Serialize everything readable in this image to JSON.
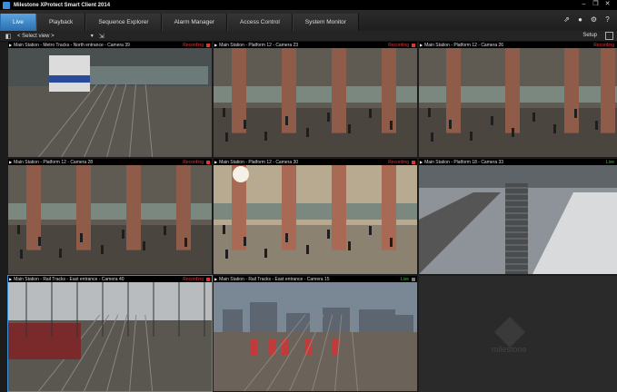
{
  "app": {
    "title": "Milestone XProtect Smart Client 2014"
  },
  "window_controls": [
    "minimize-icon",
    "restore-icon",
    "close-icon"
  ],
  "tabs": [
    {
      "label": "Live",
      "active": true
    },
    {
      "label": "Playback",
      "active": false
    },
    {
      "label": "Sequence Explorer",
      "active": false
    },
    {
      "label": "Alarm Manager",
      "active": false
    },
    {
      "label": "Access Control",
      "active": false
    },
    {
      "label": "System Monitor",
      "active": false
    }
  ],
  "toolbar_icons": [
    "pin-icon",
    "status-icon",
    "gear-icon",
    "help-icon"
  ],
  "viewbar": {
    "select_view": "< Select view >",
    "setup": "Setup"
  },
  "cameras": [
    {
      "name": "Main Station - Metro Tracks - North entrance - Camera 39",
      "status": "Recording",
      "scene": "metro-train"
    },
    {
      "name": "Main Station - Platform 12 - Camera 23",
      "status": "Recording",
      "scene": "station-hall"
    },
    {
      "name": "Main Station - Platform 12 - Camera 26",
      "status": "Recording",
      "scene": "station-hall-wide"
    },
    {
      "name": "Main Station - Platform 12 - Camera 28",
      "status": "Recording",
      "scene": "station-platform"
    },
    {
      "name": "Main Station - Platform 12 - Camera 30",
      "status": "Recording",
      "scene": "station-platform-lit"
    },
    {
      "name": "Main Station - Platform 18 - Camera 33",
      "status": "Live",
      "scene": "escalator-platform"
    },
    {
      "name": "Main Station - Rail Tracks - East entrance - Camera 40",
      "status": "Recording",
      "scene": "rail-tracks"
    },
    {
      "name": "Main Station - Rail Tracks - East entrance - Camera 15",
      "status": "Live",
      "scene": "rail-yard"
    }
  ],
  "empty_cell": {
    "watermark": "milestone"
  },
  "colors": {
    "accent": "#3a8fd6",
    "recording": "#e23a3a",
    "live": "#3dbf3d"
  }
}
